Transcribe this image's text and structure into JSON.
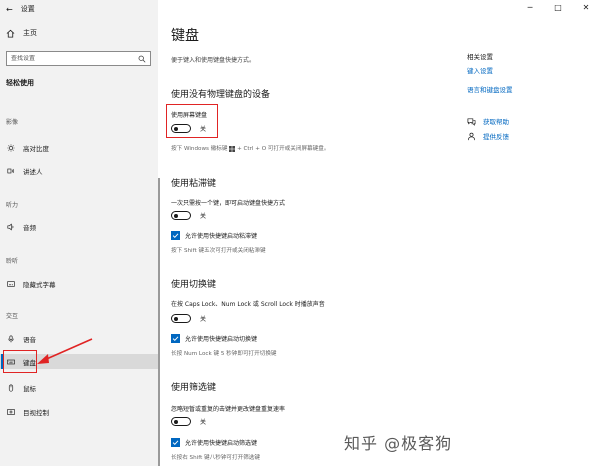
{
  "window": {
    "title": "设置"
  },
  "nav": {
    "home": "主页",
    "search_placeholder": "查找设置",
    "heading": "轻松使用",
    "groups": {
      "vision": "影像",
      "hearing": "听力",
      "interaction": "交互"
    },
    "items": [
      {
        "label": "高对比度",
        "icon": "contrast-icon"
      },
      {
        "label": "讲述人",
        "icon": "narrator-icon"
      },
      {
        "label": "音频",
        "icon": "audio-icon"
      },
      {
        "label": "隐藏式字幕",
        "icon": "caption-icon"
      },
      {
        "label": "语音",
        "icon": "microphone-icon"
      },
      {
        "label": "键盘",
        "icon": "keyboard-icon",
        "selected": true
      },
      {
        "label": "鼠标",
        "icon": "mouse-icon"
      },
      {
        "label": "目视控制",
        "icon": "eye-control-icon"
      }
    ]
  },
  "main": {
    "title": "键盘",
    "description": "便于键入和使用键盘快捷方式。",
    "onscreen": {
      "title": "使用没有物理键盘的设备",
      "label": "使用屏幕键盘",
      "state": "关",
      "hint_before": "按下 Windows 徽标键",
      "hint_after": "+ Ctrl + O 可打开或关闭屏幕键盘。"
    },
    "sticky": {
      "title": "使用粘滞键",
      "label": "一次只需按一个键，即可启动键盘快捷方式",
      "state": "关",
      "checkbox": "允许使用快捷键启动粘滞键",
      "hint": "按下 Shift 键五次可打开或关闭粘滞键"
    },
    "toggle_keys": {
      "title": "使用切换键",
      "label": "在按 Caps Lock、Num Lock 或 Scroll Lock 时播放声音",
      "state": "关",
      "checkbox": "允许使用快捷键启动切换键",
      "hint": "长按 Num Lock 键 5 秒钟即可打开切换键"
    },
    "filter_keys": {
      "title": "使用筛选键",
      "label": "忽略短暂或重复的击键并更改键盘重复速率",
      "state": "关",
      "checkbox": "允许使用快捷键启动筛选键",
      "hint": "长按右 Shift 键八秒钟可打开筛选键"
    }
  },
  "related": {
    "title": "相关设置",
    "links": [
      "键入设置",
      "语言和键盘设置"
    ],
    "help": "获取帮助",
    "feedback": "提供反馈"
  },
  "watermark": "知乎 @极客狗",
  "colors": {
    "accent": "#0067c0",
    "annotation": "#e02424",
    "nav_bg": "#f2f2f2"
  }
}
